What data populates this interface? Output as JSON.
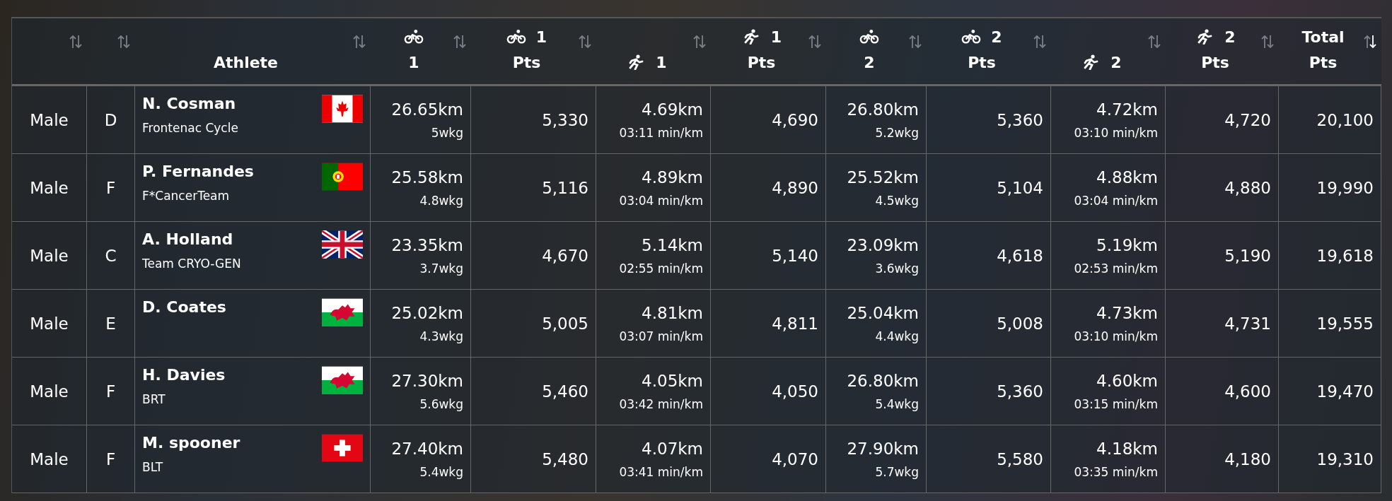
{
  "columns": [
    {
      "sorted": false
    },
    {
      "sorted": false
    },
    {
      "sorted": false,
      "bottom": {
        "text": "Athlete"
      }
    },
    {
      "sorted": false,
      "top": {
        "kind": "bike"
      },
      "bottom": {
        "text": "1"
      }
    },
    {
      "sorted": false,
      "top": {
        "kind": "bike",
        "text": "1"
      },
      "bottom": {
        "text": "Pts"
      }
    },
    {
      "sorted": false,
      "bottom": {
        "kind": "run",
        "text": "1"
      }
    },
    {
      "sorted": false,
      "top": {
        "kind": "run",
        "text": "1"
      },
      "bottom": {
        "text": "Pts"
      }
    },
    {
      "sorted": false,
      "top": {
        "kind": "bike"
      },
      "bottom": {
        "text": "2"
      }
    },
    {
      "sorted": false,
      "top": {
        "kind": "bike",
        "text": "2"
      },
      "bottom": {
        "text": "Pts"
      }
    },
    {
      "sorted": false,
      "bottom": {
        "kind": "run",
        "text": "2"
      }
    },
    {
      "sorted": false,
      "top": {
        "kind": "run",
        "text": "2"
      },
      "bottom": {
        "text": "Pts"
      }
    },
    {
      "sorted": true,
      "top": {
        "text": "Total"
      },
      "bottom": {
        "text": "Pts"
      }
    }
  ],
  "rows": [
    {
      "gender": "Male",
      "category": "D",
      "athlete": {
        "name": "N. Cosman",
        "team": "Frontenac Cycle",
        "flag": {
          "kind": "canada"
        }
      },
      "results": [
        {
          "main": "26.65km",
          "sub": "5wkg"
        },
        {
          "main": "5,330"
        },
        {
          "main": "4.69km",
          "sub": "03:11 min/km"
        },
        {
          "main": "4,690"
        },
        {
          "main": "26.80km",
          "sub": "5.2wkg"
        },
        {
          "main": "5,360"
        },
        {
          "main": "4.72km",
          "sub": "03:10 min/km"
        },
        {
          "main": "4,720"
        },
        {
          "main": "20,100"
        }
      ]
    },
    {
      "gender": "Male",
      "category": "F",
      "athlete": {
        "name": "P. Fernandes",
        "team": "F*CancerTeam",
        "flag": {
          "kind": "portugal"
        }
      },
      "results": [
        {
          "main": "25.58km",
          "sub": "4.8wkg"
        },
        {
          "main": "5,116"
        },
        {
          "main": "4.89km",
          "sub": "03:04 min/km"
        },
        {
          "main": "4,890"
        },
        {
          "main": "25.52km",
          "sub": "4.5wkg"
        },
        {
          "main": "5,104"
        },
        {
          "main": "4.88km",
          "sub": "03:04 min/km"
        },
        {
          "main": "4,880"
        },
        {
          "main": "19,990"
        }
      ]
    },
    {
      "gender": "Male",
      "category": "C",
      "athlete": {
        "name": "A. Holland",
        "team": "Team CRYO-GEN",
        "flag": {
          "kind": "uk"
        }
      },
      "results": [
        {
          "main": "23.35km",
          "sub": "3.7wkg"
        },
        {
          "main": "4,670"
        },
        {
          "main": "5.14km",
          "sub": "02:55 min/km"
        },
        {
          "main": "5,140"
        },
        {
          "main": "23.09km",
          "sub": "3.6wkg"
        },
        {
          "main": "4,618"
        },
        {
          "main": "5.19km",
          "sub": "02:53 min/km"
        },
        {
          "main": "5,190"
        },
        {
          "main": "19,618"
        }
      ]
    },
    {
      "gender": "Male",
      "category": "E",
      "athlete": {
        "name": "D. Coates",
        "flag": {
          "kind": "wales"
        }
      },
      "results": [
        {
          "main": "25.02km",
          "sub": "4.3wkg"
        },
        {
          "main": "5,005"
        },
        {
          "main": "4.81km",
          "sub": "03:07 min/km"
        },
        {
          "main": "4,811"
        },
        {
          "main": "25.04km",
          "sub": "4.4wkg"
        },
        {
          "main": "5,008"
        },
        {
          "main": "4.73km",
          "sub": "03:10 min/km"
        },
        {
          "main": "4,731"
        },
        {
          "main": "19,555"
        }
      ]
    },
    {
      "gender": "Male",
      "category": "F",
      "athlete": {
        "name": "H. Davies",
        "team": "BRT",
        "flag": {
          "kind": "wales"
        }
      },
      "results": [
        {
          "main": "27.30km",
          "sub": "5.6wkg"
        },
        {
          "main": "5,460"
        },
        {
          "main": "4.05km",
          "sub": "03:42 min/km"
        },
        {
          "main": "4,050"
        },
        {
          "main": "26.80km",
          "sub": "5.4wkg"
        },
        {
          "main": "5,360"
        },
        {
          "main": "4.60km",
          "sub": "03:15 min/km"
        },
        {
          "main": "4,600"
        },
        {
          "main": "19,470"
        }
      ]
    },
    {
      "gender": "Male",
      "category": "F",
      "athlete": {
        "name": "M. spooner",
        "team": "BLT",
        "flag": {
          "kind": "switzerland"
        }
      },
      "results": [
        {
          "main": "27.40km",
          "sub": "5.4wkg"
        },
        {
          "main": "5,480"
        },
        {
          "main": "4.07km",
          "sub": "03:41 min/km"
        },
        {
          "main": "4,070"
        },
        {
          "main": "27.90km",
          "sub": "5.7wkg"
        },
        {
          "main": "5,580"
        },
        {
          "main": "4.18km",
          "sub": "03:35 min/km"
        },
        {
          "main": "4,180"
        },
        {
          "main": "19,310"
        }
      ]
    }
  ]
}
